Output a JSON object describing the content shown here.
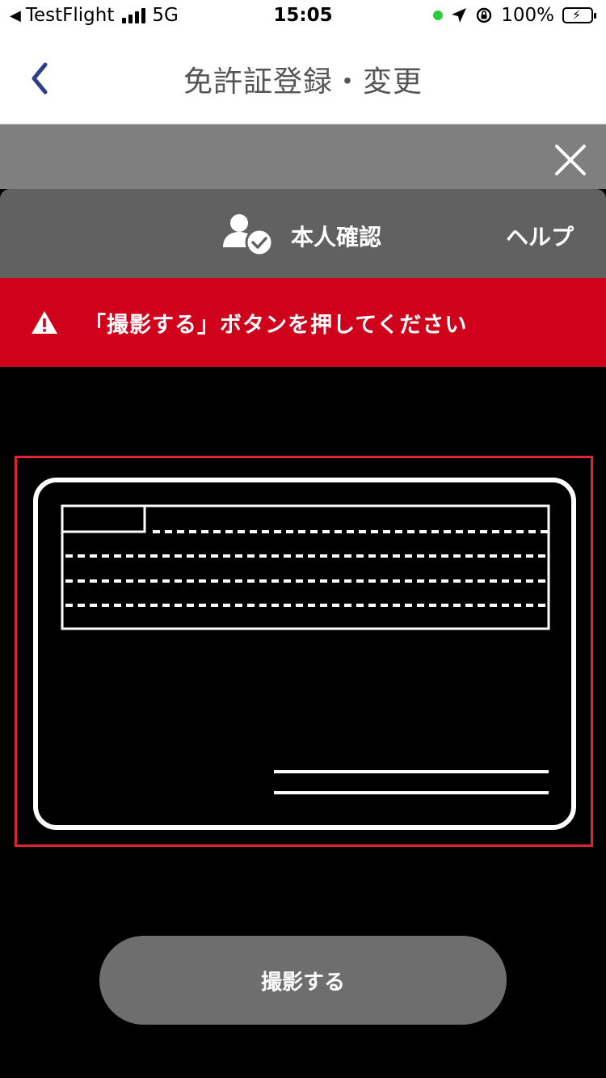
{
  "status_bar": {
    "back_app": "TestFlight",
    "network": "5G",
    "time": "15:05",
    "battery": "100%",
    "icons": [
      "back-arrow-icon",
      "signal-icon",
      "location-icon",
      "rotation-lock-icon",
      "battery-charging-icon"
    ]
  },
  "nav": {
    "title": "免許証登録・変更",
    "back_icon": "chevron-left-icon"
  },
  "verify_bar": {
    "title": "本人確認",
    "help_label": "ヘルプ"
  },
  "alert": {
    "message": "「撮影する」ボタンを押してください"
  },
  "capture_button": {
    "label": "撮影する"
  },
  "colors": {
    "accent_blue": "#2b3f8c",
    "alert_red": "#d0011b",
    "frame_red": "#e0242f",
    "button_gray": "#6e6e6e"
  }
}
